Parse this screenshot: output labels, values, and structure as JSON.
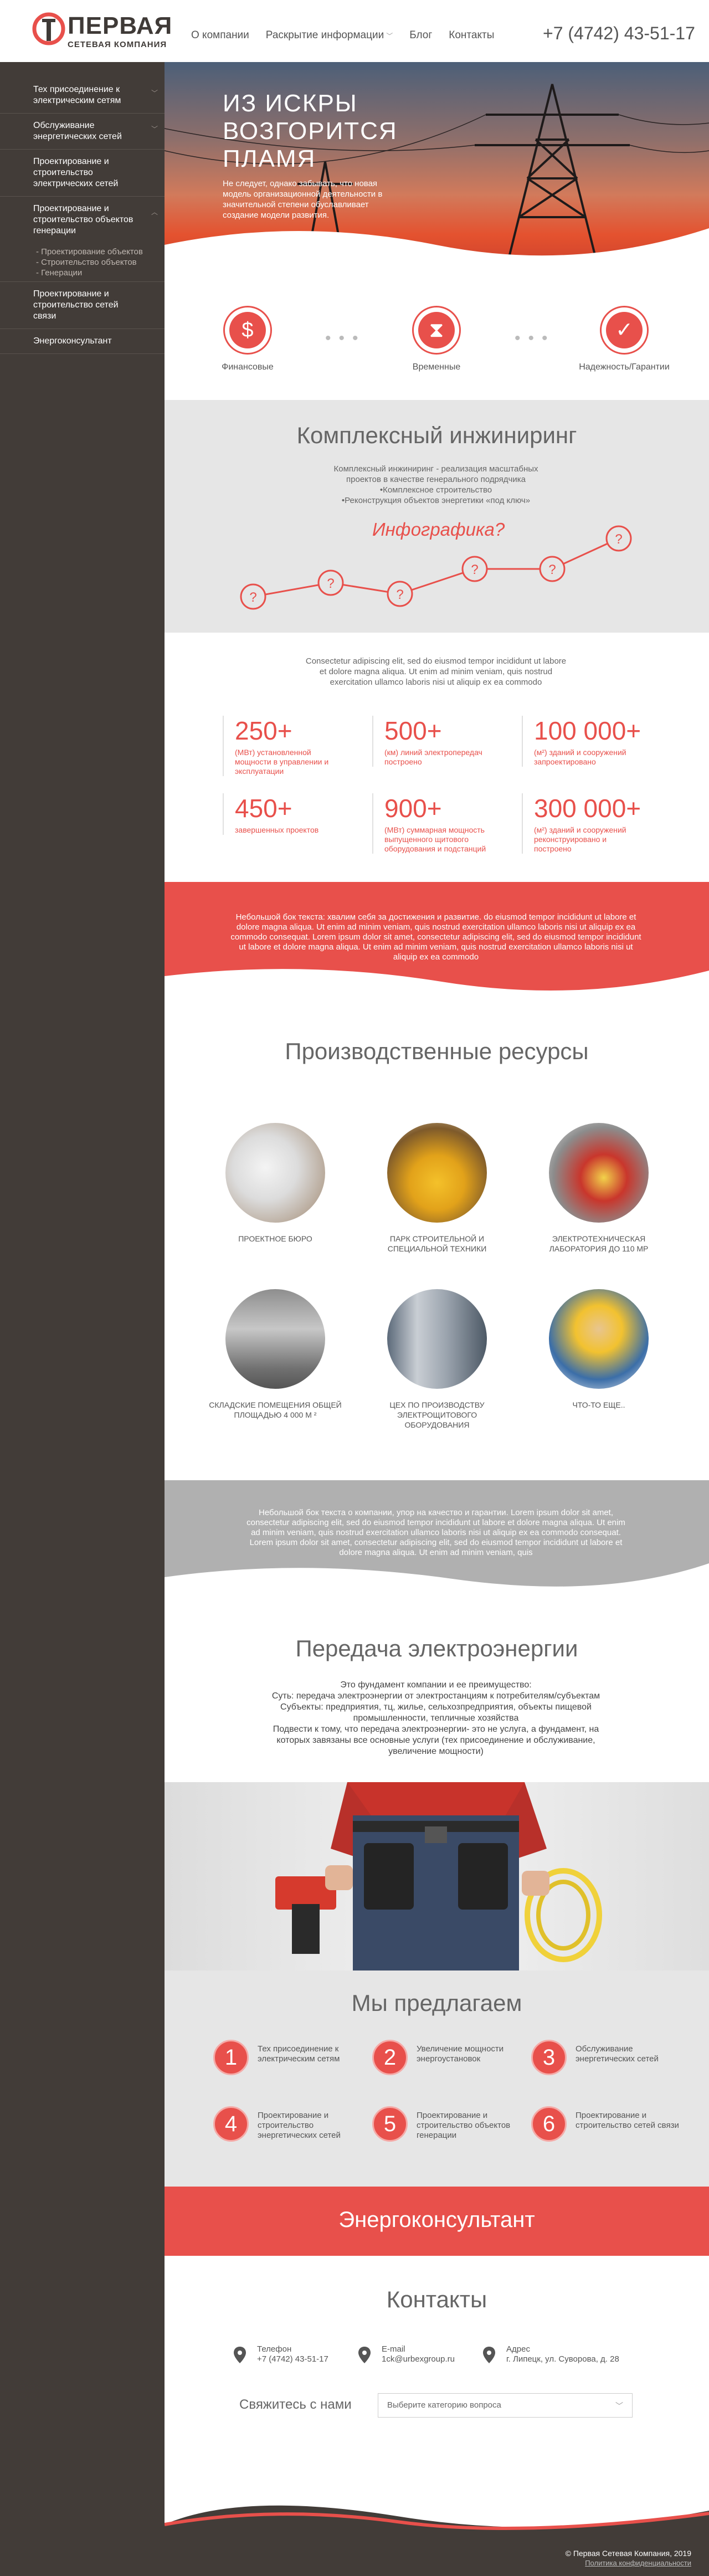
{
  "header": {
    "logo_title": "ПЕРВАЯ",
    "logo_subtitle": "СЕТЕВАЯ КОМПАНИЯ",
    "nav": [
      "О компании",
      "Раскрытие информации",
      "Блог",
      "Контакты"
    ],
    "phone": "+7 (4742) 43-51-17"
  },
  "sidebar": {
    "items": [
      {
        "label": "Тех присоединение к электрическим сетям"
      },
      {
        "label": "Обслуживание энергетических сетей"
      },
      {
        "label": "Проектирование и строительство электрических сетей"
      },
      {
        "label": "Проектирование и строительство объектов генерации"
      },
      {
        "label": "Проектирование и строительство сетей связи"
      },
      {
        "label": "Энергоконсультант"
      }
    ],
    "subitems": [
      "Проектирование объектов",
      "Строительство объектов",
      "Генерации"
    ]
  },
  "hero": {
    "title": "ИЗ ИСКРЫ ВОЗГОРИТСЯ ПЛАМЯ",
    "text": "Не следует, однако забывать, что новая модель организационной деятельности в значительной степени обуславливает создание модели развития."
  },
  "features": [
    {
      "label": "Финансовые",
      "icon": "dollar-icon"
    },
    {
      "label": "Временные",
      "icon": "hourglass-icon"
    },
    {
      "label": "Надежность/Гарантии",
      "icon": "check-badge-icon"
    }
  ],
  "engineering": {
    "title": "Комплексный инжиниринг",
    "lines": [
      "Комплексный инжиниринг - реализация масштабных проектов в качестве генерального подрядчика",
      "•Комплексное строительство",
      "•Реконструкция объектов энергетики «под ключ»"
    ],
    "infographic_title": "Инфографика?",
    "marker": "?"
  },
  "stats": {
    "intro": "Consectetur adipiscing elit, sed do eiusmod tempor incididunt ut labore et dolore magna aliqua. Ut enim ad minim veniam, quis nostrud exercitation ullamco laboris nisi ut aliquip ex ea commodo",
    "items": [
      {
        "num": "250+",
        "label": "(МВт) установленной мощности в управлении и эксплуатации"
      },
      {
        "num": "500+",
        "label": "(км) линий электропередач построено"
      },
      {
        "num": "100 000+",
        "label": "(м²) зданий и сооружений запроектировано"
      },
      {
        "num": "450+",
        "label": "завершенных проектов"
      },
      {
        "num": "900+",
        "label": "(МВт) суммарная мощность выпущенного щитового оборудования и подстанций"
      },
      {
        "num": "300 000+",
        "label": "(м²) зданий и сооружений реконструировано и построено"
      }
    ]
  },
  "red_band": {
    "text": "Небольшой бок текста: хвалим себя за достижения и развитие. do eiusmod tempor incididunt ut labore et dolore magna aliqua. Ut enim ad minim veniam, quis nostrud exercitation ullamco laboris nisi ut aliquip ex ea commodo consequat. Lorem ipsum dolor sit amet, consectetur adipiscing elit, sed do eiusmod tempor incididunt ut labore et dolore magna aliqua. Ut enim ad minim veniam, quis nostrud exercitation ullamco laboris nisi ut aliquip ex ea commodo"
  },
  "resources": {
    "title": "Производственные ресурсы",
    "items": [
      {
        "label": "ПРОЕКТНОЕ БЮРО"
      },
      {
        "label": "ПАРК СТРОИТЕЛЬНОЙ И СПЕЦИАЛЬНОЙ ТЕХНИКИ"
      },
      {
        "label": "ЭЛЕКТРОТЕХНИЧЕСКАЯ ЛАБОРАТОРИЯ ДО 110 ΜΡ"
      },
      {
        "label": "СКЛАДСКИЕ ПОМЕЩЕНИЯ ОБЩЕЙ ПЛОЩАДЬЮ 4 000 М ²"
      },
      {
        "label": "ЦЕХ ПО ПРОИЗВОДСТВУ ЭЛЕКТРОЩИТОВОГО ОБОРУДОВАНИЯ"
      },
      {
        "label": "ЧТО-ТО ЕЩЕ.."
      }
    ]
  },
  "gray_band": {
    "text": "Небольшой бок текста о компании, упор на качество и гарантии. Lorem ipsum dolor sit amet, consectetur adipiscing elit, sed do eiusmod tempor incididunt ut labore et dolore magna aliqua. Ut enim ad minim veniam, quis nostrud exercitation ullamco laboris nisi ut aliquip ex ea commodo consequat. Lorem ipsum dolor sit amet, consectetur adipiscing elit, sed do eiusmod tempor incididunt ut labore et dolore magna aliqua. Ut enim ad minim veniam, quis"
  },
  "transmission": {
    "title": "Передача электроэнергии",
    "lines": [
      "Это фундамент компании и ее преимущество:",
      "Суть: передача электроэнергии от электростанциям к потребителям/субъектам",
      "Субъекты: предприятия, тц, жилье, сельхозпредприятия, объекты пищевой промышленности, тепличные хозяйства",
      "Подвести к тому, что передача электроэнергии- это не услуга, а фундамент, на которых завязаны все основные услуги (тех присоединение и обслуживание, увеличение мощности)"
    ]
  },
  "offer": {
    "title": "Мы предлагаем",
    "items": [
      {
        "num": "1",
        "label": "Тех присоединение к электрическим сетям"
      },
      {
        "num": "2",
        "label": "Увеличение мощности энергоустановок"
      },
      {
        "num": "3",
        "label": "Обслуживание энергетических сетей"
      },
      {
        "num": "4",
        "label": "Проектирование и строительство энергетических сетей"
      },
      {
        "num": "5",
        "label": "Проектирование и строительство объектов генерации"
      },
      {
        "num": "6",
        "label": "Проектирование и строительство сетей связи"
      }
    ]
  },
  "energo": {
    "title": "Энергоконсультант"
  },
  "contacts": {
    "title": "Контакты",
    "items": [
      {
        "label": "Телефон",
        "value": "+7 (4742) 43-51-17"
      },
      {
        "label": "E-mail",
        "value": "1ck@urbexgroup.ru"
      },
      {
        "label": "Адрес",
        "value": "г. Липецк, ул. Суворова, д. 28"
      }
    ],
    "ask": "Свяжитесь с нами",
    "select_placeholder": "Выберите категорию вопроса"
  },
  "footer": {
    "copyright": "© Первая Сетевая Компания, 2019",
    "policy": "Политика конфиденциальности"
  },
  "colors": {
    "accent": "#e8504b",
    "sidebar": "#423c38",
    "gray": "#e6e6e6"
  }
}
